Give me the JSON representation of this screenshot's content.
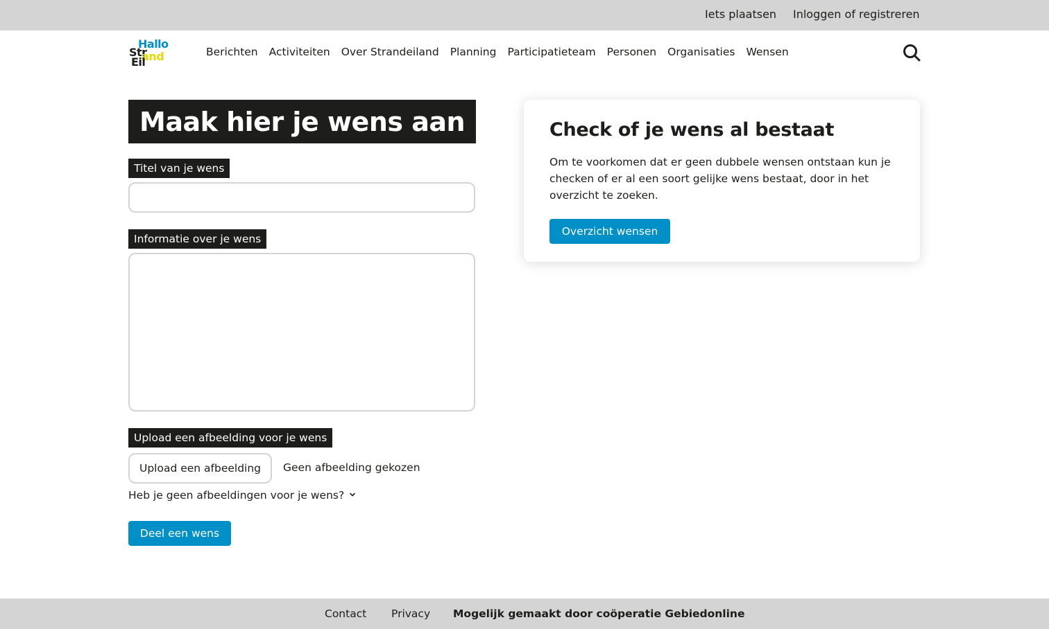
{
  "topbar": {
    "post_label": "Iets plaatsen",
    "login_label": "Inloggen of registreren"
  },
  "logo": {
    "line1": "Hallo",
    "line2": "Str",
    "line3": "and",
    "line4": "Eil",
    "colors": {
      "blue": "#0090c8",
      "yellow": "#e4d800",
      "dark": "#1d1d1b"
    }
  },
  "nav": {
    "items": [
      {
        "label": "Berichten"
      },
      {
        "label": "Activiteiten"
      },
      {
        "label": "Over Strandeiland"
      },
      {
        "label": "Planning"
      },
      {
        "label": "Participatieteam"
      },
      {
        "label": "Personen"
      },
      {
        "label": "Organisaties"
      },
      {
        "label": "Wensen"
      }
    ],
    "search_icon": "search-icon"
  },
  "form": {
    "heading": "Maak hier je wens aan",
    "title_label": "Titel van je wens",
    "title_value": "",
    "info_label": "Informatie over je wens",
    "info_value": "",
    "upload_label": "Upload een afbeelding voor je wens",
    "upload_button": "Upload een afbeelding",
    "upload_status": "Geen afbeelding gekozen",
    "no_images_toggle": "Heb je geen afbeeldingen voor je wens?",
    "submit_label": "Deel een wens"
  },
  "sidebar_card": {
    "title": "Check of je wens al bestaat",
    "body": "Om te voorkomen dat er geen dubbele wensen ontstaan kun je checken of er al een soort gelijke wens bestaat, door in het overzicht te zoeken.",
    "button_label": "Overzicht wensen"
  },
  "footer": {
    "contact": "Contact",
    "privacy": "Privacy",
    "credit": "Mogelijk gemaakt door coöperatie Gebiedonline"
  },
  "colors": {
    "accent": "#0090c8",
    "bar_bg": "#d4d4d4",
    "label_bg": "#1d1d1b"
  }
}
